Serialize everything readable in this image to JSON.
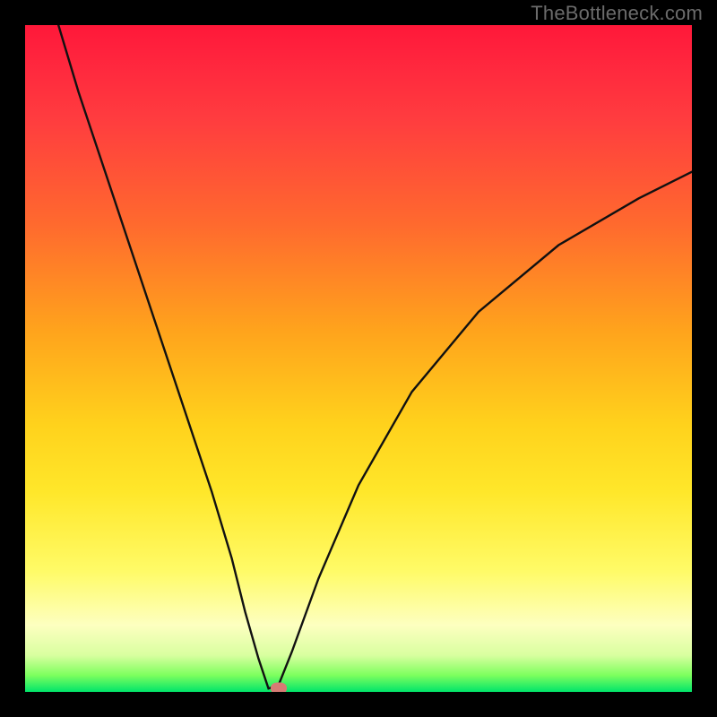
{
  "watermark": "TheBottleneck.com",
  "colors": {
    "frame_bg": "#000000",
    "curve_stroke": "#111111",
    "marker_fill": "#d67b74",
    "gradient_stops": [
      "#ff1839",
      "#ff223d",
      "#ff3c3f",
      "#ff6a2e",
      "#ffa41c",
      "#ffd21c",
      "#ffe72a",
      "#fffb68",
      "#fdffc0",
      "#d9ffa0",
      "#7dff5e",
      "#00e56a"
    ]
  },
  "chart_data": {
    "type": "line",
    "title": "",
    "xlabel": "",
    "ylabel": "",
    "xlim": [
      0,
      100
    ],
    "ylim": [
      0,
      100
    ],
    "grid": false,
    "legend": false,
    "annotations": [],
    "minimum": {
      "x": 37,
      "y": 0
    },
    "series": [
      {
        "name": "curve",
        "x": [
          5,
          8,
          12,
          16,
          20,
          24,
          28,
          31,
          33,
          35,
          36.5,
          38,
          40,
          44,
          50,
          58,
          68,
          80,
          92,
          100
        ],
        "y": [
          100,
          90,
          78,
          66,
          54,
          42,
          30,
          20,
          12,
          5,
          0.5,
          1,
          6,
          17,
          31,
          45,
          57,
          67,
          74,
          78
        ]
      }
    ],
    "marker_point": {
      "x": 38,
      "y": 0.5
    }
  }
}
